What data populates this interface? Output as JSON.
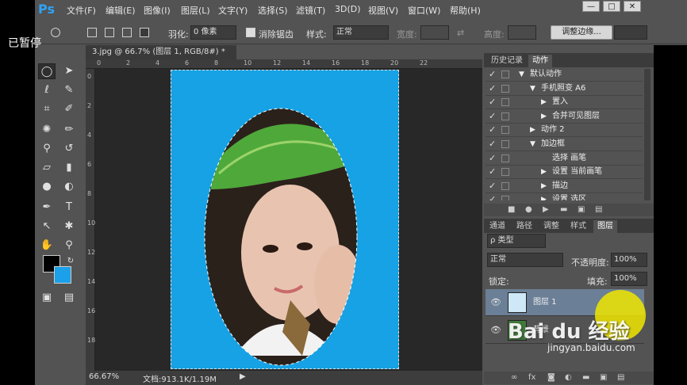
{
  "app": {
    "logo": "Ps"
  },
  "menu": [
    "文件(F)",
    "编辑(E)",
    "图像(I)",
    "图层(L)",
    "文字(Y)",
    "选择(S)",
    "滤镜(T)",
    "3D(D)",
    "视图(V)",
    "窗口(W)",
    "帮助(H)"
  ],
  "window_controls": {
    "minimize": "—",
    "maximize": "□",
    "close": "✕"
  },
  "overlay": {
    "paused": "已暂停"
  },
  "options": {
    "feather_label": "羽化:",
    "feather_value": "0 像素",
    "antialias_label": "消除锯齿",
    "style_label": "样式:",
    "style_value": "正常",
    "width_label": "宽度:",
    "height_label": "高度:",
    "refine_button": "调整边缘..."
  },
  "document": {
    "tab_title": "3.jpg @ 66.7% (图层 1, RGB/8#) *",
    "zoom": "66.67%",
    "doc_info": "文档:913.1K/1.19M",
    "ruler_top": [
      "0",
      "2",
      "4",
      "6",
      "8",
      "10",
      "12",
      "14",
      "16",
      "18",
      "20",
      "22"
    ],
    "ruler_left": [
      "0",
      "2",
      "4",
      "6",
      "8",
      "10",
      "12",
      "14",
      "16",
      "18"
    ]
  },
  "actions_panel": {
    "tabs": [
      "历史记录",
      "动作"
    ],
    "active_tab": "动作",
    "rows": [
      {
        "label": "默认动作",
        "indent": 0,
        "arrow": "▼"
      },
      {
        "label": "手机照变 A6",
        "indent": 1,
        "arrow": "▼"
      },
      {
        "label": "置入",
        "indent": 2,
        "arrow": "▶"
      },
      {
        "label": "合并可见图层",
        "indent": 2,
        "arrow": "▶"
      },
      {
        "label": "动作 2",
        "indent": 1,
        "arrow": "▶"
      },
      {
        "label": "加边框",
        "indent": 1,
        "arrow": "▼"
      },
      {
        "label": "选择 画笔",
        "indent": 2,
        "arrow": ""
      },
      {
        "label": "设置 当前画笔",
        "indent": 2,
        "arrow": "▶"
      },
      {
        "label": "描边",
        "indent": 2,
        "arrow": "▶"
      },
      {
        "label": "设置 选区",
        "indent": 2,
        "arrow": "▶"
      }
    ]
  },
  "layers_panel": {
    "tabs": [
      "通道",
      "路径",
      "调整",
      "样式",
      "图层"
    ],
    "active_tab": "图层",
    "filter_label": "ρ 类型",
    "blend_mode": "正常",
    "opacity_label": "不透明度:",
    "opacity_value": "100%",
    "lock_label": "锁定:",
    "fill_label": "填充:",
    "fill_value": "100%",
    "layers": [
      {
        "name": "图层 1",
        "selected": true
      },
      {
        "name": "背景",
        "selected": false
      }
    ]
  },
  "watermark": {
    "brand": "Bai du 经验",
    "url": "jingyan.baidu.com"
  },
  "colors": {
    "accent": "#2fa3f6",
    "canvas_bg": "#16a2e4",
    "panel": "#535353",
    "cursor_highlight": "#f0e600"
  }
}
